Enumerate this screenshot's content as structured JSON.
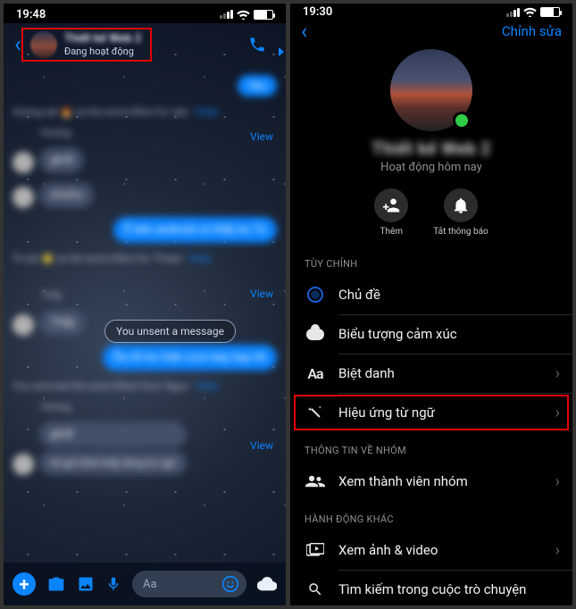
{
  "left": {
    "status": {
      "time": "19:48"
    },
    "header": {
      "name_blurred": "Thiết kế Web 2",
      "status": "Đang hoạt động"
    },
    "bubbles": {
      "sent1": "Yêu",
      "sys1": "Hương set 🔥 as the word effect for 'yêu'",
      "view": "View",
      "recv1": "ghớt",
      "recv2": "ohoho",
      "sent2": "Ê bên android có thấy ko Tú",
      "sys2": "Tú set 🌟 as the word effect for 'Thuận'",
      "unsent": "You unsent a message",
      "recv3": "Thấy",
      "sent3": "Ôa rồi ko hiện icon bay bay hả",
      "sys3": "You removed the word effect from 'Ngọc'",
      "recv4": "ghớt",
      "recv5": "tôi gửi đình thấy dòng từ ngữ"
    },
    "composer": {
      "placeholder": "Aa"
    }
  },
  "right": {
    "status": {
      "time": "19:30"
    },
    "header": {
      "edit": "Chỉnh sửa"
    },
    "profile": {
      "name_blurred": "Thiết kế Web 2",
      "status": "Hoạt động hôm nay",
      "add": "Thêm",
      "mute": "Tắt thông báo"
    },
    "sections": {
      "customize": "TÙY CHỈNH",
      "group_info": "THÔNG TIN VỀ NHÓM",
      "other_actions": "HÀNH ĐỘNG KHÁC"
    },
    "items": {
      "theme": "Chủ đề",
      "emoji": "Biểu tượng cảm xúc",
      "nickname": "Biệt danh",
      "word_effect": "Hiệu ứng từ ngữ",
      "members": "Xem thành viên nhóm",
      "media": "Xem ảnh & video",
      "search": "Tìm kiếm trong cuộc trò chuyện"
    }
  }
}
